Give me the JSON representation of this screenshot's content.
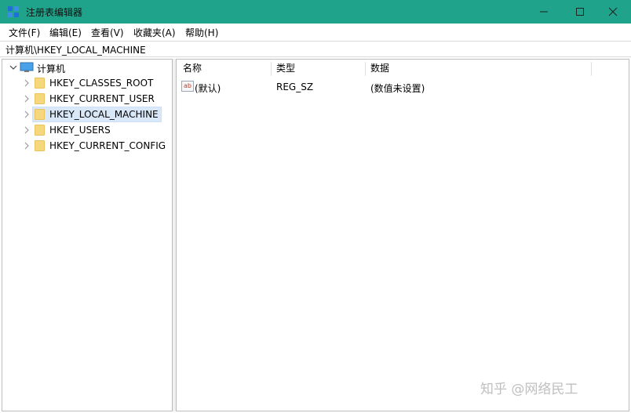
{
  "window": {
    "title": "注册表编辑器"
  },
  "menu": [
    "文件(F)",
    "编辑(E)",
    "查看(V)",
    "收藏夹(A)",
    "帮助(H)"
  ],
  "address": "计算机\\HKEY_LOCAL_MACHINE",
  "tree": {
    "root": "计算机",
    "items": [
      {
        "label": "HKEY_CLASSES_ROOT",
        "selected": false
      },
      {
        "label": "HKEY_CURRENT_USER",
        "selected": false
      },
      {
        "label": "HKEY_LOCAL_MACHINE",
        "selected": true
      },
      {
        "label": "HKEY_USERS",
        "selected": false
      },
      {
        "label": "HKEY_CURRENT_CONFIG",
        "selected": false
      }
    ]
  },
  "list": {
    "columns": [
      "名称",
      "类型",
      "数据"
    ],
    "rows": [
      {
        "name": "(默认)",
        "type": "REG_SZ",
        "data": "(数值未设置)",
        "icon": "string-value-icon"
      }
    ]
  },
  "watermark": "知乎 @网络民工",
  "colors": {
    "titlebar": "#1fa38a",
    "selection": "#d9e8f9",
    "folder": "#f5d77e"
  }
}
